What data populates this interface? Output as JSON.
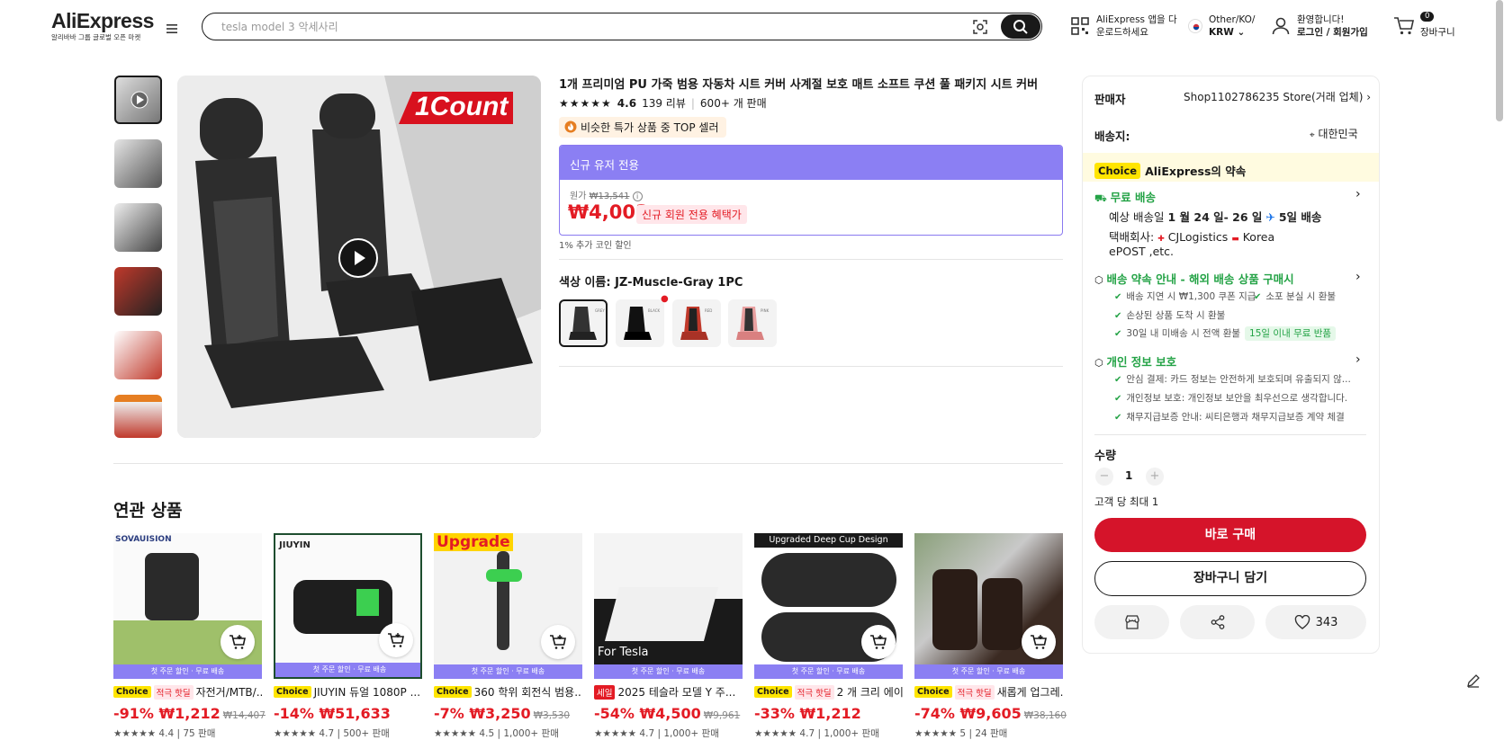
{
  "header": {
    "logo": "AliExpress",
    "logo_sub": "알리바바 그룹 글로벌 오픈 마켓",
    "search_placeholder": "tesla model 3 악세사리",
    "app_line1": "AliExpress 앱을 다",
    "app_line2": "운로드하세요",
    "region_line1": "Other/KO/",
    "region_line2": "KRW",
    "user_line1": "환영합니다!",
    "user_line2": "로그인 / 회원가입",
    "cart_count": "0",
    "cart_label": "장바구니"
  },
  "product": {
    "title": "1개 프리미엄 PU 가죽 범용 자동차 시트 커버 사계절 보호 매트 소프트 쿠션 풀 패키지 시트 커버",
    "image_badge": "1Count",
    "rating": "4.6",
    "reviews": "139 리뷰",
    "sold": "600+ 개 판매",
    "top_seller": "비슷한 특가 상품 중 TOP 셀러",
    "new_user_header": "신규 유저 전용",
    "orig_label": "원가",
    "orig_price": "₩13,541",
    "price": "₩4,003",
    "price_tag": "신규 회원 전용 혜택가",
    "coin": "1% 추가 코인 할인",
    "color_label": "색상 이름: ",
    "color_value": "JZ-Muscle-Gray 1PC",
    "swatches": [
      "GREY",
      "BLACK",
      "RED",
      "PINK"
    ]
  },
  "panel": {
    "seller_label": "판매자",
    "seller_value": "Shop1102786235 Store(거래 업체)",
    "ship_label": "배송지:",
    "ship_value": "대한민국",
    "choice_tag": "Choice",
    "choice_text": "AliExpress의 약속",
    "free_ship": "무료 배송",
    "eta_prefix": "예상 배송일",
    "eta_range": "1 월 24 일- 26 일",
    "eta_fast": "5일 배송",
    "carrier_label": "택배회사:",
    "carrier1": "CJLogistics",
    "carrier2": "Korea",
    "carrier3": "ePOST ,etc.",
    "promise_title": "배송 약속 안내 - 해외 배송 상품 구매시",
    "promise_items": [
      "배송 지연 시 ₩1,300 쿠폰 지급",
      "소포 분실 시 환불",
      "손상된 상품 도착 시 환불",
      "30일 내 미배송 시 전액 환불"
    ],
    "promise_tag": "15일 이내 무료 반품",
    "privacy_title": "개인 정보 보호",
    "privacy_items": [
      "안심 결제: 카드 정보는 안전하게 보호되며 유출되지 않...",
      "개인정보 보호: 개인정보 보안을 최우선으로 생각합니다.",
      "채무지급보증 안내: 씨티은행과 채무지급보증 계약 체결"
    ],
    "qty_label": "수량",
    "qty_value": "1",
    "qty_limit": "고객 당 최대 1",
    "buy_now": "바로 구매",
    "add_cart": "장바구니 담기",
    "wishlist_count": "343"
  },
  "related": {
    "title": "연관 상품",
    "strip_text": "첫 주문 할인 · 무료 배송",
    "items": [
      {
        "img_text": "SOVAUISION",
        "tag1": "Choice",
        "tag2": "적극 핫딜",
        "title": "자전거/MTB/...",
        "discount": "-91%",
        "price": "₩1,212",
        "orig": "₩14,407",
        "rating": "4.4 | 75 판매"
      },
      {
        "img_text": "JIUYIN",
        "tag1": "Choice",
        "tag2": "",
        "title": "JIUYIN 듀얼 1080P ...",
        "discount": "-14%",
        "price": "₩51,633",
        "orig": "",
        "rating": "4.7 | 500+ 판매"
      },
      {
        "img_text": "Upgrade",
        "tag1": "Choice",
        "tag2": "",
        "title": "360 학위 회전식 범용...",
        "discount": "-7%",
        "price": "₩3,250",
        "orig": "₩3,530",
        "rating": "4.5 | 1,000+ 판매"
      },
      {
        "img_text": "For Tesla",
        "tag1": "세일",
        "tag2": "",
        "title": "2025 테슬라 모델 Y 주...",
        "discount": "-54%",
        "price": "₩4,500",
        "orig": "₩9,961",
        "rating": "4.7 | 1,000+ 판매"
      },
      {
        "img_text": "Upgraded Deep Cup Design",
        "tag1": "Choice",
        "tag2": "적극 핫딜",
        "title": "2 개 크리 에이...",
        "discount": "-33%",
        "price": "₩1,212",
        "orig": "",
        "rating": "4.7 | 1,000+ 판매"
      },
      {
        "img_text": "",
        "tag1": "Choice",
        "tag2": "적극 핫딜",
        "title": "새롭게 업그레...",
        "discount": "-74%",
        "price": "₩9,605",
        "orig": "₩38,160",
        "rating": "5 | 24 판매"
      }
    ]
  }
}
